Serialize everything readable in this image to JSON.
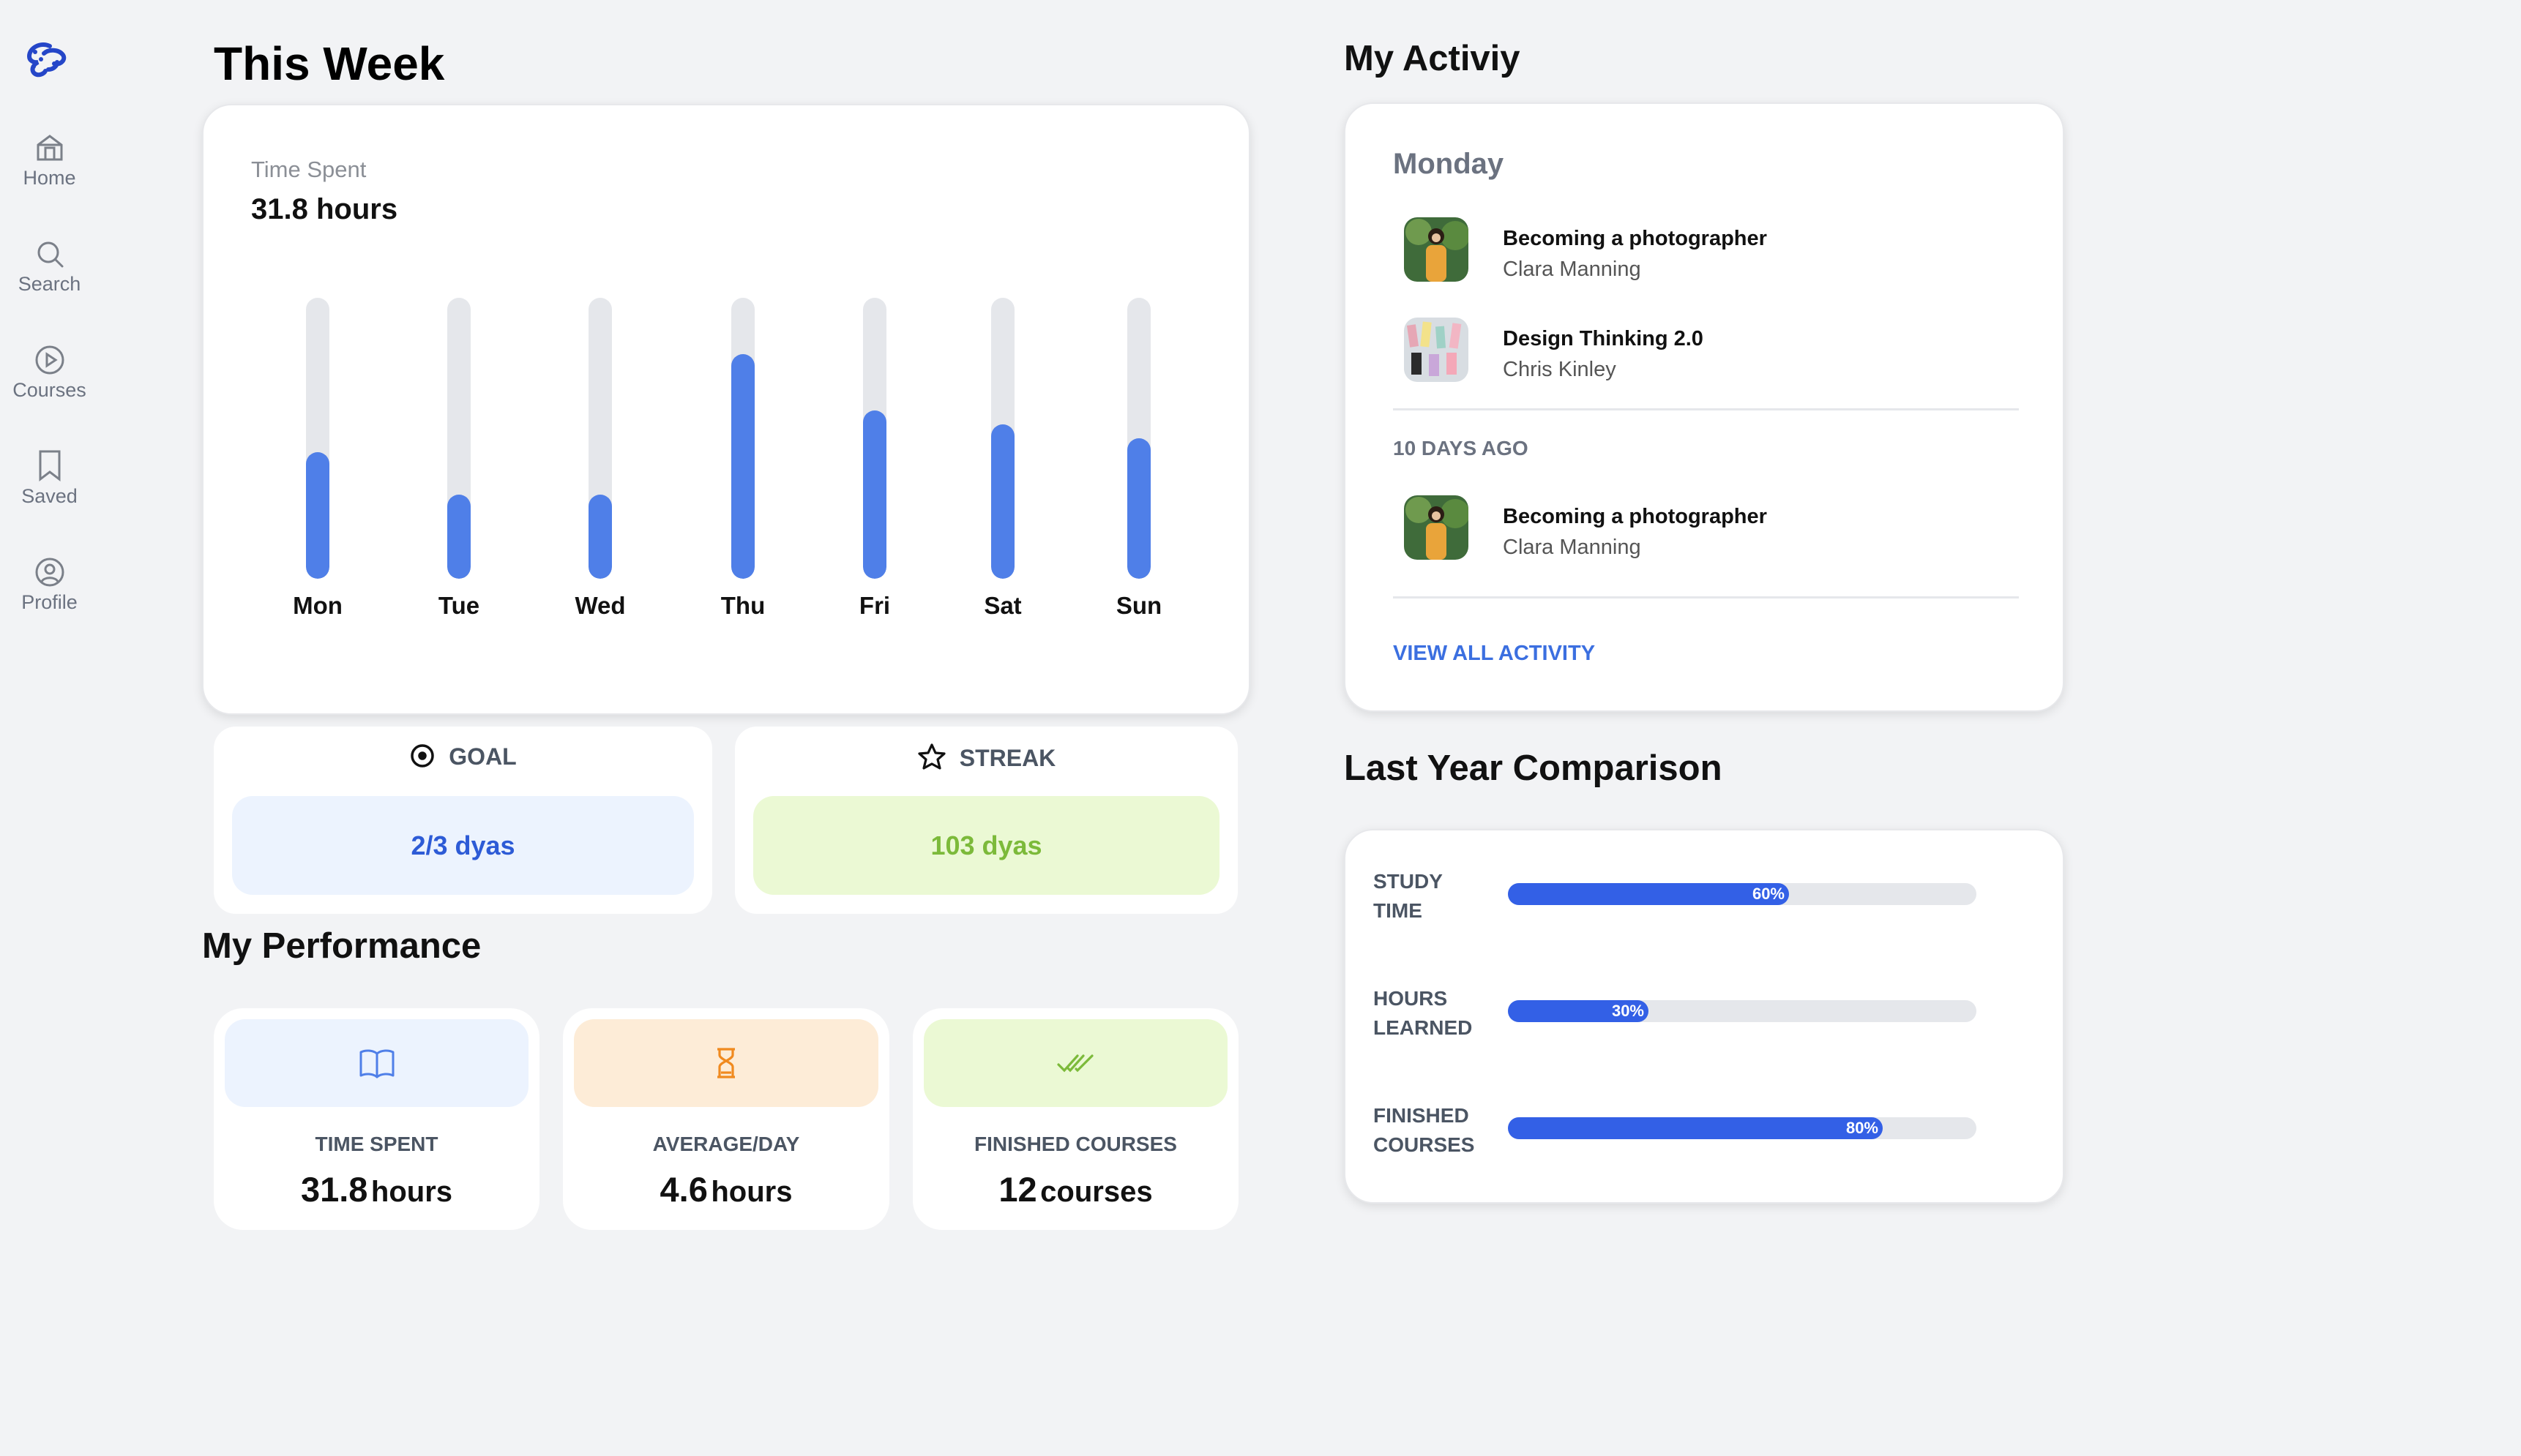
{
  "sidebar": {
    "items": [
      {
        "label": "Home",
        "icon": "home-icon"
      },
      {
        "label": "Search",
        "icon": "search-icon"
      },
      {
        "label": "Courses",
        "icon": "play-icon"
      },
      {
        "label": "Saved",
        "icon": "bookmark-icon"
      },
      {
        "label": "Profile",
        "icon": "user-icon"
      }
    ]
  },
  "this_week": {
    "title": "This Week",
    "time_spent_label": "Time Spent",
    "time_spent_value": "31.8 hours",
    "chart_data": {
      "type": "bar",
      "categories": [
        "Mon",
        "Tue",
        "Wed",
        "Thu",
        "Fri",
        "Sat",
        "Sun"
      ],
      "values": [
        0.45,
        0.3,
        0.3,
        0.8,
        0.6,
        0.55,
        0.5
      ],
      "ylim": [
        0,
        1
      ],
      "color": "#4f7fe8"
    }
  },
  "goal": {
    "label": "GOAL",
    "value": "2/3 dyas",
    "icon": "target-icon"
  },
  "streak": {
    "label": "STREAK",
    "value": "103 dyas",
    "icon": "star-icon"
  },
  "performance": {
    "title": "My Performance",
    "cards": [
      {
        "label": "TIME SPENT",
        "number": "31.8",
        "unit": "hours",
        "icon": "book-icon"
      },
      {
        "label": "AVERAGE/DAY",
        "number": "4.6",
        "unit": "hours",
        "icon": "hourglass-icon"
      },
      {
        "label": "FINISHED COURSES",
        "number": "12",
        "unit": "courses",
        "icon": "double-check-icon"
      }
    ]
  },
  "activity": {
    "title": "My Activiy",
    "day_label": "Monday",
    "items": [
      {
        "title": "Becoming a photographer",
        "author": "Clara Manning"
      },
      {
        "title": "Design Thinking 2.0",
        "author": "Chris Kinley"
      }
    ],
    "older_label": "10 DAYS AGO",
    "older_items": [
      {
        "title": "Becoming a photographer",
        "author": "Clara Manning"
      }
    ],
    "view_all": "VIEW ALL ACTIVITY"
  },
  "comparison": {
    "title": "Last Year Comparison",
    "chart_data": {
      "type": "bar",
      "categories": [
        "STUDY TIME",
        "HOURS LEARNED",
        "FINISHED COURSES"
      ],
      "values": [
        60,
        30,
        80
      ],
      "value_labels": [
        "60%",
        "30%",
        "80%"
      ],
      "ylim": [
        0,
        100
      ],
      "color": "#3360e6"
    }
  }
}
